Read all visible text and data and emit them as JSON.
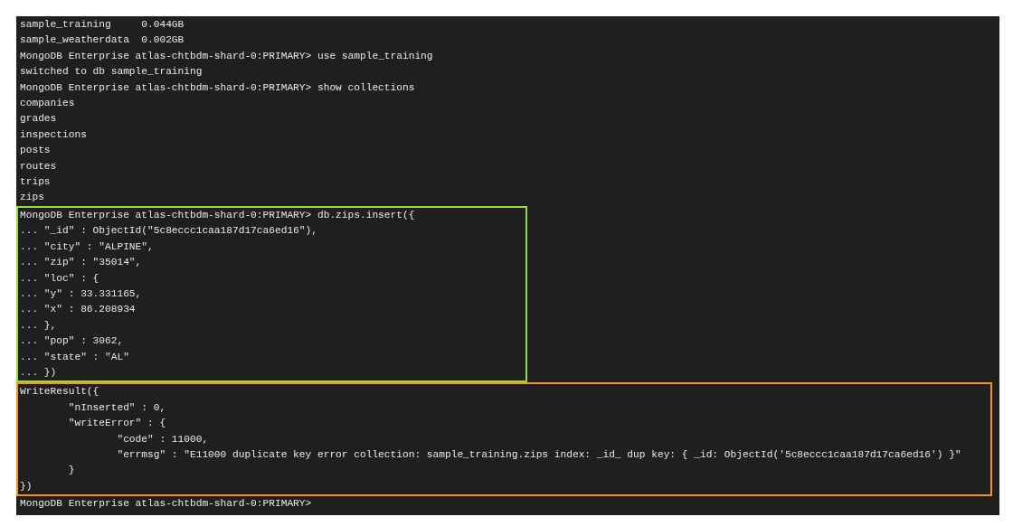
{
  "terminal": {
    "blocks": [
      {
        "kind": "plain",
        "lines": [
          "sample_training     0.044GB",
          "sample_weatherdata  0.002GB",
          "MongoDB Enterprise atlas-chtbdm-shard-0:PRIMARY> use sample_training",
          "switched to db sample_training",
          "MongoDB Enterprise atlas-chtbdm-shard-0:PRIMARY> show collections",
          "companies",
          "grades",
          "inspections",
          "posts",
          "routes",
          "trips",
          "zips"
        ]
      },
      {
        "kind": "highlight",
        "color": "#8fe03a",
        "lines": [
          "MongoDB Enterprise atlas-chtbdm-shard-0:PRIMARY> db.zips.insert({",
          "... \"_id\" : ObjectId(\"5c8eccc1caa187d17ca6ed16\"),",
          "... \"city\" : \"ALPINE\",",
          "... \"zip\" : \"35014\",",
          "... \"loc\" : {",
          "... \"y\" : 33.331165,",
          "... \"x\" : 86.208934",
          "... },",
          "... \"pop\" : 3062,",
          "... \"state\" : \"AL\"",
          "... })"
        ]
      },
      {
        "kind": "highlight",
        "color": "#f7921e",
        "lines": [
          "WriteResult({",
          "        \"nInserted\" : 0,",
          "        \"writeError\" : {",
          "                \"code\" : 11000,",
          "                \"errmsg\" : \"E11000 duplicate key error collection: sample_training.zips index: _id_ dup key: { _id: ObjectId('5c8eccc1caa187d17ca6ed16') }\"",
          "        }",
          "})"
        ]
      },
      {
        "kind": "plain",
        "lines": [
          "MongoDB Enterprise atlas-chtbdm-shard-0:PRIMARY>"
        ]
      }
    ]
  }
}
